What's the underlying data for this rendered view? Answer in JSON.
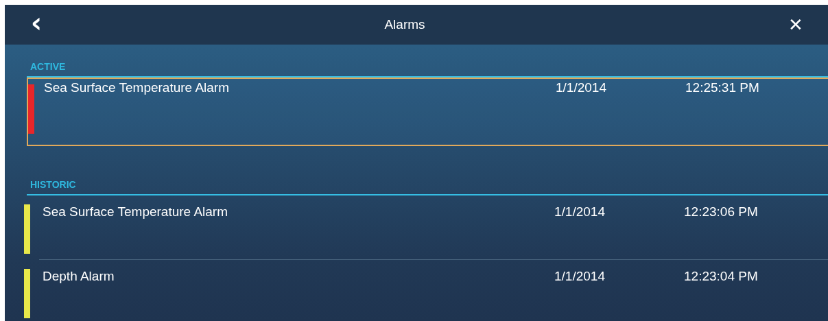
{
  "header": {
    "title": "Alarms",
    "back": "‹",
    "close": "✕"
  },
  "sections": [
    {
      "label": "ACTIVE",
      "alarms": [
        {
          "name": "Sea Surface Temperature Alarm",
          "date": "1/1/2014",
          "time": "12:25:31 PM",
          "color": "#e8262a",
          "selected": true
        }
      ]
    },
    {
      "label": "HISTORIC",
      "alarms": [
        {
          "name": "Sea Surface Temperature Alarm",
          "date": "1/1/2014",
          "time": "12:23:06 PM",
          "color": "#e8e84a",
          "selected": false
        },
        {
          "name": "Depth Alarm",
          "date": "1/1/2014",
          "time": "12:23:04 PM",
          "color": "#e8e84a",
          "selected": false
        }
      ]
    }
  ]
}
